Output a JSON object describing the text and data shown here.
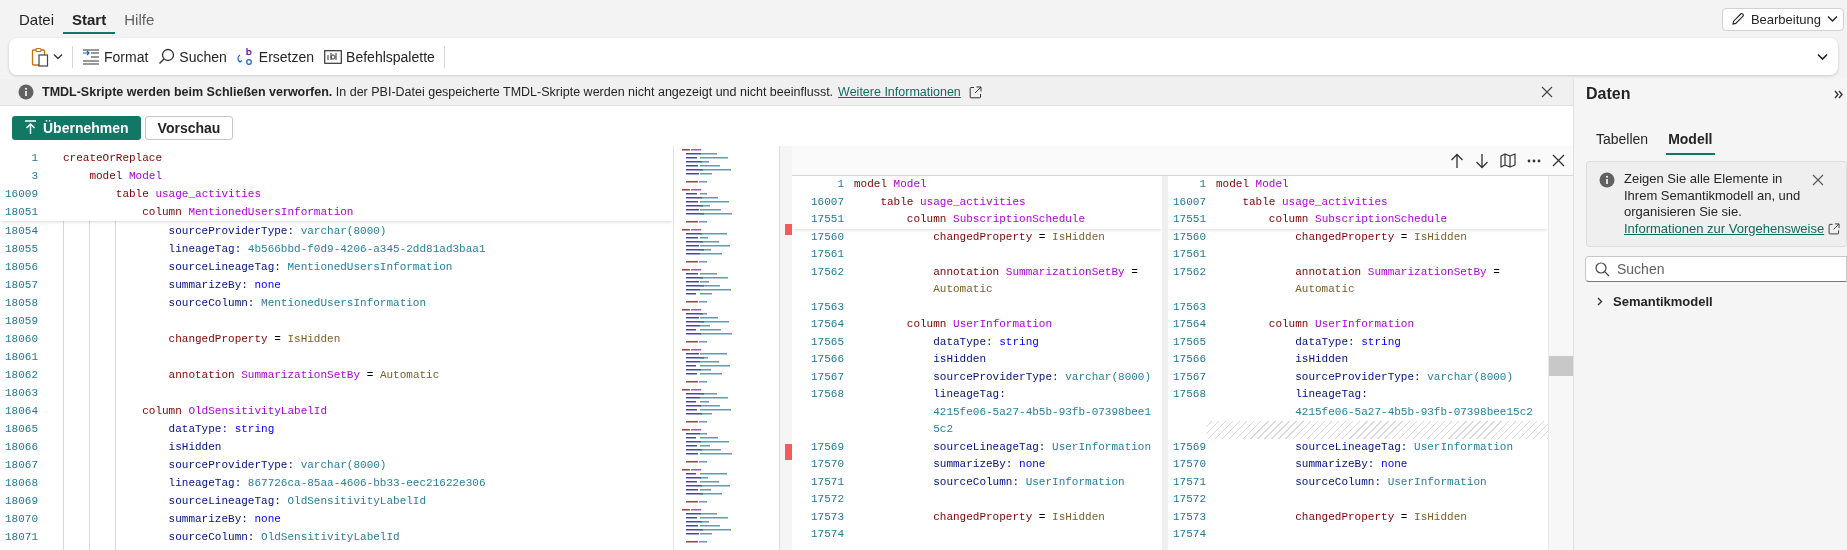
{
  "menu": [
    {
      "label": "Datei",
      "selected": false
    },
    {
      "label": "Start",
      "selected": true
    },
    {
      "label": "Hilfe",
      "selected": false
    }
  ],
  "mode_button": {
    "label": "Bearbeitung"
  },
  "toolbar": [
    {
      "kind": "clipboard"
    },
    {
      "kind": "format",
      "label": "Format"
    },
    {
      "kind": "search",
      "label": "Suchen"
    },
    {
      "kind": "replace",
      "label": "Ersetzen"
    },
    {
      "kind": "palette",
      "label": "Befehlspalette"
    }
  ],
  "info_bar": {
    "message": "**TMDL-Skripte werden beim Schließen verworfen.** In der PBI-Datei gespeicherte TMDL-Skripte werden nicht angezeigt und nicht beeinflusst.",
    "link": "Weitere Informationen"
  },
  "actions": [
    {
      "kind": "primary",
      "label": "Übernehmen"
    },
    {
      "kind": "secondary",
      "label": "Vorschau"
    }
  ],
  "editor": {
    "sticky": [
      {
        "no": "1",
        "tokens": [
          {
            "kind": "keyword",
            "text": "createOrReplace"
          }
        ]
      },
      {
        "no": "3",
        "tokens": [
          {
            "kind": "keyword",
            "text": "    model "
          },
          {
            "kind": "name",
            "text": "Model"
          }
        ]
      },
      {
        "no": "16009",
        "tokens": [
          {
            "kind": "keyword",
            "text": "        table "
          },
          {
            "kind": "name",
            "text": "usage_activities"
          }
        ]
      },
      {
        "no": "18051",
        "tokens": [
          {
            "kind": "keyword",
            "text": "            column "
          },
          {
            "kind": "name",
            "text": "MentionedUsersInformation"
          }
        ]
      }
    ],
    "lines": [
      {
        "no": "18054",
        "tokens": [
          {
            "kind": "property",
            "text": "                sourceProviderType: "
          },
          {
            "kind": "value",
            "text": "varchar(8000)"
          }
        ]
      },
      {
        "no": "18055",
        "tokens": [
          {
            "kind": "property",
            "text": "                lineageTag: "
          },
          {
            "kind": "value",
            "text": "4b566bbd-f0d9-4206-a345-2dd81ad3baa1"
          }
        ]
      },
      {
        "no": "18056",
        "tokens": [
          {
            "kind": "property",
            "text": "                sourceLineageTag: "
          },
          {
            "kind": "value",
            "text": "MentionedUsersInformation"
          }
        ]
      },
      {
        "no": "18057",
        "tokens": [
          {
            "kind": "property",
            "text": "                summarizeBy: "
          },
          {
            "kind": "constant",
            "text": "none"
          }
        ]
      },
      {
        "no": "18058",
        "tokens": [
          {
            "kind": "property",
            "text": "                sourceColumn: "
          },
          {
            "kind": "value",
            "text": "MentionedUsersInformation"
          }
        ]
      },
      {
        "no": "18059"
      },
      {
        "no": "18060",
        "tokens": [
          {
            "kind": "keyword",
            "text": "                changedProperty"
          },
          {
            "kind": "plain",
            "text": " = "
          },
          {
            "kind": "literal",
            "text": "IsHidden"
          }
        ]
      },
      {
        "no": "18061"
      },
      {
        "no": "18062",
        "tokens": [
          {
            "kind": "keyword",
            "text": "                annotation "
          },
          {
            "kind": "name",
            "text": "SummarizationSetBy"
          },
          {
            "kind": "plain",
            "text": " = "
          },
          {
            "kind": "literal",
            "text": "Automatic"
          }
        ]
      },
      {
        "no": "18063"
      },
      {
        "no": "18064",
        "tokens": [
          {
            "kind": "keyword",
            "text": "            column "
          },
          {
            "kind": "name",
            "text": "OldSensitivityLabelId"
          }
        ]
      },
      {
        "no": "18065",
        "tokens": [
          {
            "kind": "property",
            "text": "                dataType: "
          },
          {
            "kind": "constant",
            "text": "string"
          }
        ]
      },
      {
        "no": "18066",
        "tokens": [
          {
            "kind": "property",
            "text": "                isHidden"
          }
        ]
      },
      {
        "no": "18067",
        "tokens": [
          {
            "kind": "property",
            "text": "                sourceProviderType: "
          },
          {
            "kind": "value",
            "text": "varchar(8000)"
          }
        ]
      },
      {
        "no": "18068",
        "tokens": [
          {
            "kind": "property",
            "text": "                lineageTag: "
          },
          {
            "kind": "value",
            "text": "867726ca-85aa-4606-bb33-eec21622e306"
          }
        ]
      },
      {
        "no": "18069",
        "tokens": [
          {
            "kind": "property",
            "text": "                sourceLineageTag: "
          },
          {
            "kind": "value",
            "text": "OldSensitivityLabelId"
          }
        ]
      },
      {
        "no": "18070",
        "tokens": [
          {
            "kind": "property",
            "text": "                summarizeBy: "
          },
          {
            "kind": "constant",
            "text": "none"
          }
        ]
      },
      {
        "no": "18071",
        "tokens": [
          {
            "kind": "property",
            "text": "                sourceColumn: "
          },
          {
            "kind": "value",
            "text": "OldSensitivityLabelId"
          }
        ]
      }
    ]
  },
  "diff": {
    "panes": [
      {
        "sticky": [
          {
            "no": "1",
            "tokens": [
              {
                "kind": "keyword",
                "text": "model "
              },
              {
                "kind": "name",
                "text": "Model"
              }
            ]
          },
          {
            "no": "16007",
            "tokens": [
              {
                "kind": "keyword",
                "text": "    table "
              },
              {
                "kind": "name",
                "text": "usage_activities"
              }
            ]
          },
          {
            "no": "17551",
            "tokens": [
              {
                "kind": "keyword",
                "text": "        column "
              },
              {
                "kind": "name",
                "text": "SubscriptionSchedule"
              }
            ]
          }
        ],
        "lines": [
          {
            "kind": "code",
            "no": "17560",
            "tokens": [
              {
                "kind": "keyword",
                "text": "            changedProperty"
              },
              {
                "kind": "plain",
                "text": " = "
              },
              {
                "kind": "literal",
                "text": "IsHidden"
              }
            ]
          },
          {
            "kind": "code",
            "no": "17561"
          },
          {
            "kind": "code",
            "no": "17562",
            "tokens": [
              {
                "kind": "keyword",
                "text": "            annotation "
              },
              {
                "kind": "name",
                "text": "SummarizationSetBy"
              },
              {
                "kind": "plain",
                "text": " ="
              }
            ]
          },
          {
            "kind": "code",
            "tokens": [
              {
                "kind": "literal",
                "text": "            Automatic"
              }
            ]
          },
          {
            "kind": "code",
            "no": "17563"
          },
          {
            "kind": "code",
            "no": "17564",
            "tokens": [
              {
                "kind": "keyword",
                "text": "        column "
              },
              {
                "kind": "name",
                "text": "UserInformation"
              }
            ]
          },
          {
            "kind": "code",
            "no": "17565",
            "tokens": [
              {
                "kind": "property",
                "text": "            dataType: "
              },
              {
                "kind": "constant",
                "text": "string"
              }
            ]
          },
          {
            "kind": "code",
            "no": "17566",
            "tokens": [
              {
                "kind": "property",
                "text": "            isHidden"
              }
            ]
          },
          {
            "kind": "code",
            "no": "17567",
            "tokens": [
              {
                "kind": "property",
                "text": "            sourceProviderType: "
              },
              {
                "kind": "value",
                "text": "varchar(8000)"
              }
            ]
          },
          {
            "kind": "code",
            "no": "17568",
            "tokens": [
              {
                "kind": "property",
                "text": "            lineageTag:"
              }
            ]
          },
          {
            "kind": "code",
            "tokens": [
              {
                "kind": "value",
                "text": "            4215fe06-5a27-4b5b-93fb-07398bee1"
              }
            ]
          },
          {
            "kind": "code",
            "tokens": [
              {
                "kind": "value",
                "text": "            5c2"
              }
            ]
          },
          {
            "kind": "code",
            "no": "17569",
            "tokens": [
              {
                "kind": "property",
                "text": "            sourceLineageTag: "
              },
              {
                "kind": "value",
                "text": "UserInformation"
              }
            ]
          },
          {
            "kind": "code",
            "no": "17570",
            "tokens": [
              {
                "kind": "property",
                "text": "            summarizeBy: "
              },
              {
                "kind": "constant",
                "text": "none"
              }
            ]
          },
          {
            "kind": "code",
            "no": "17571",
            "tokens": [
              {
                "kind": "property",
                "text": "            sourceColumn: "
              },
              {
                "kind": "value",
                "text": "UserInformation"
              }
            ]
          },
          {
            "kind": "code",
            "no": "17572"
          },
          {
            "kind": "code",
            "no": "17573",
            "tokens": [
              {
                "kind": "keyword",
                "text": "            changedProperty"
              },
              {
                "kind": "plain",
                "text": " = "
              },
              {
                "kind": "literal",
                "text": "IsHidden"
              }
            ]
          },
          {
            "kind": "code",
            "no": "17574"
          }
        ]
      },
      {
        "sticky": [
          {
            "no": "1",
            "tokens": [
              {
                "kind": "keyword",
                "text": "model "
              },
              {
                "kind": "name",
                "text": "Model"
              }
            ]
          },
          {
            "no": "16007",
            "tokens": [
              {
                "kind": "keyword",
                "text": "    table "
              },
              {
                "kind": "name",
                "text": "usage_activities"
              }
            ]
          },
          {
            "no": "17551",
            "tokens": [
              {
                "kind": "keyword",
                "text": "        column "
              },
              {
                "kind": "name",
                "text": "SubscriptionSchedule"
              }
            ]
          }
        ],
        "lines": [
          {
            "kind": "code",
            "no": "17560",
            "tokens": [
              {
                "kind": "keyword",
                "text": "            changedProperty"
              },
              {
                "kind": "plain",
                "text": " = "
              },
              {
                "kind": "literal",
                "text": "IsHidden"
              }
            ]
          },
          {
            "kind": "code",
            "no": "17561"
          },
          {
            "kind": "code",
            "no": "17562",
            "tokens": [
              {
                "kind": "keyword",
                "text": "            annotation "
              },
              {
                "kind": "name",
                "text": "SummarizationSetBy"
              },
              {
                "kind": "plain",
                "text": " ="
              }
            ]
          },
          {
            "kind": "code",
            "tokens": [
              {
                "kind": "literal",
                "text": "            Automatic"
              }
            ]
          },
          {
            "kind": "code",
            "no": "17563"
          },
          {
            "kind": "code",
            "no": "17564",
            "tokens": [
              {
                "kind": "keyword",
                "text": "        column "
              },
              {
                "kind": "name",
                "text": "UserInformation"
              }
            ]
          },
          {
            "kind": "code",
            "no": "17565",
            "tokens": [
              {
                "kind": "property",
                "text": "            dataType: "
              },
              {
                "kind": "constant",
                "text": "string"
              }
            ]
          },
          {
            "kind": "code",
            "no": "17566",
            "tokens": [
              {
                "kind": "property",
                "text": "            isHidden"
              }
            ]
          },
          {
            "kind": "code",
            "no": "17567",
            "tokens": [
              {
                "kind": "property",
                "text": "            sourceProviderType: "
              },
              {
                "kind": "value",
                "text": "varchar(8000)"
              }
            ]
          },
          {
            "kind": "code",
            "no": "17568",
            "tokens": [
              {
                "kind": "property",
                "text": "            lineageTag:"
              }
            ]
          },
          {
            "kind": "code",
            "tokens": [
              {
                "kind": "value",
                "text": "            4215fe06-5a27-4b5b-93fb-07398bee15c2"
              }
            ]
          },
          {
            "kind": "filler"
          },
          {
            "kind": "code",
            "no": "17569",
            "tokens": [
              {
                "kind": "property",
                "text": "            sourceLineageTag: "
              },
              {
                "kind": "value",
                "text": "UserInformation"
              }
            ]
          },
          {
            "kind": "code",
            "no": "17570",
            "tokens": [
              {
                "kind": "property",
                "text": "            summarizeBy: "
              },
              {
                "kind": "constant",
                "text": "none"
              }
            ]
          },
          {
            "kind": "code",
            "no": "17571",
            "tokens": [
              {
                "kind": "property",
                "text": "            sourceColumn: "
              },
              {
                "kind": "value",
                "text": "UserInformation"
              }
            ]
          },
          {
            "kind": "code",
            "no": "17572"
          },
          {
            "kind": "code",
            "no": "17573",
            "tokens": [
              {
                "kind": "keyword",
                "text": "            changedProperty"
              },
              {
                "kind": "plain",
                "text": " = "
              },
              {
                "kind": "literal",
                "text": "IsHidden"
              }
            ]
          },
          {
            "kind": "code",
            "no": "17574"
          }
        ]
      }
    ]
  },
  "data_panel": {
    "title": "Daten",
    "tabs": [
      {
        "label": "Tabellen",
        "selected": false
      },
      {
        "label": "Modell",
        "selected": true
      }
    ],
    "tip": {
      "text": "Zeigen Sie alle Elemente in Ihrem Semantikmodell an, und organisieren Sie sie.",
      "link": "Informationen zur Vorgehensweise"
    },
    "search": {
      "placeholder": "Suchen"
    },
    "tree": [
      {
        "label": "Semantikmodell",
        "expanded": false
      }
    ]
  }
}
